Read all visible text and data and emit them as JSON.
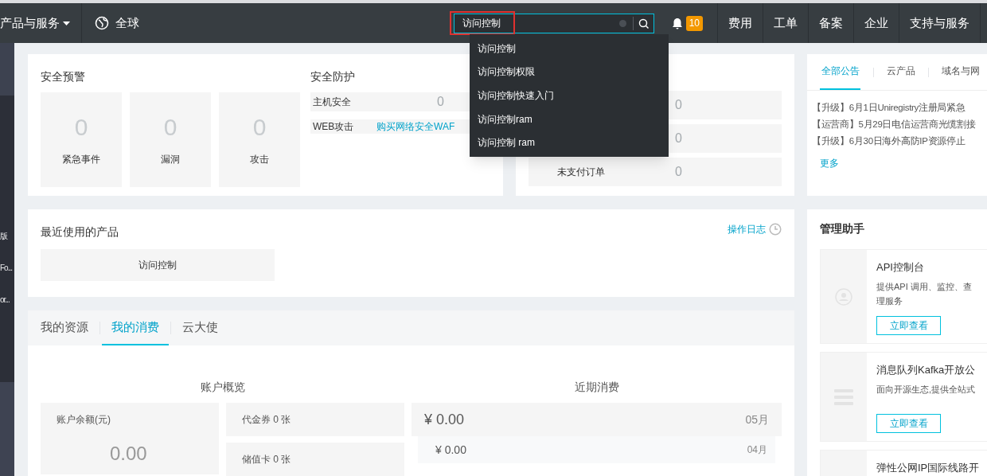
{
  "nav": {
    "menu": "产品与服务",
    "region": "全球",
    "search": {
      "value": "访问控制",
      "marked": true
    },
    "badge": "10",
    "links": [
      "费用",
      "工单",
      "备案",
      "企业",
      "支持与服务"
    ]
  },
  "search_suggestions": [
    "访问控制",
    "访问控制权限",
    "访问控制快速入门",
    "访问控制ram",
    "访问控制 ram"
  ],
  "sidebar": {
    "items": [
      "版",
      "Fo...",
      "or..."
    ]
  },
  "security_alerts": {
    "title": "安全预警",
    "tiles": [
      {
        "value": "0",
        "label": "紧急事件"
      },
      {
        "value": "0",
        "label": "漏洞"
      },
      {
        "value": "0",
        "label": "攻击"
      }
    ]
  },
  "security_protection": {
    "title": "安全防护",
    "rows": [
      {
        "label": "主机安全",
        "value": "0"
      },
      {
        "label": "WEB攻击",
        "link": "购买网络安全WAF"
      }
    ]
  },
  "orders": {
    "rows": [
      {
        "value": "0"
      },
      {
        "value": "0"
      },
      {
        "label": "未支付订单",
        "value": "0"
      }
    ]
  },
  "notices": {
    "tabs": [
      {
        "label": "全部公告",
        "selected": true
      },
      {
        "label": "云产品",
        "selected": false
      },
      {
        "label": "域名与网",
        "selected": false
      }
    ],
    "items": [
      "【升级】6月1日Uniregistry注册局紧急",
      "【运营商】5月29日电信运营商光缆割接",
      "【升级】6月30日海外高防IP资源停止"
    ],
    "more": "更多"
  },
  "recent_products": {
    "title": "最近使用的产品",
    "log_link": "操作日志",
    "items": [
      "访问控制"
    ]
  },
  "consumption": {
    "tabs": [
      {
        "label": "我的资源",
        "selected": false
      },
      {
        "label": "我的消费",
        "selected": true
      },
      {
        "label": "云大使",
        "selected": false
      }
    ],
    "overview": {
      "title": "账户概览",
      "balance_label": "账户余额(元)",
      "balance": "0.00",
      "vouchers": "代金券 0 张",
      "stored_cards": "储值卡 0 张"
    },
    "recent": {
      "title": "近期消费",
      "rows": [
        {
          "amount": "¥ 0.00",
          "month": "05月"
        },
        {
          "amount": "¥ 0.00",
          "month": "04月"
        }
      ]
    }
  },
  "assistant": {
    "title": "管理助手",
    "items": [
      {
        "kind": "user",
        "title": "API控制台",
        "lines": [
          "提供API 调用、监控、查",
          "理服务"
        ],
        "button": "立即查看"
      },
      {
        "kind": "list",
        "title": "消息队列Kafka开放公",
        "lines": [
          "面向开源生态,提供全站式"
        ],
        "button": "立即查看"
      },
      {
        "kind": "blank",
        "title": "弹性公网IP国际线路开"
      }
    ]
  }
}
